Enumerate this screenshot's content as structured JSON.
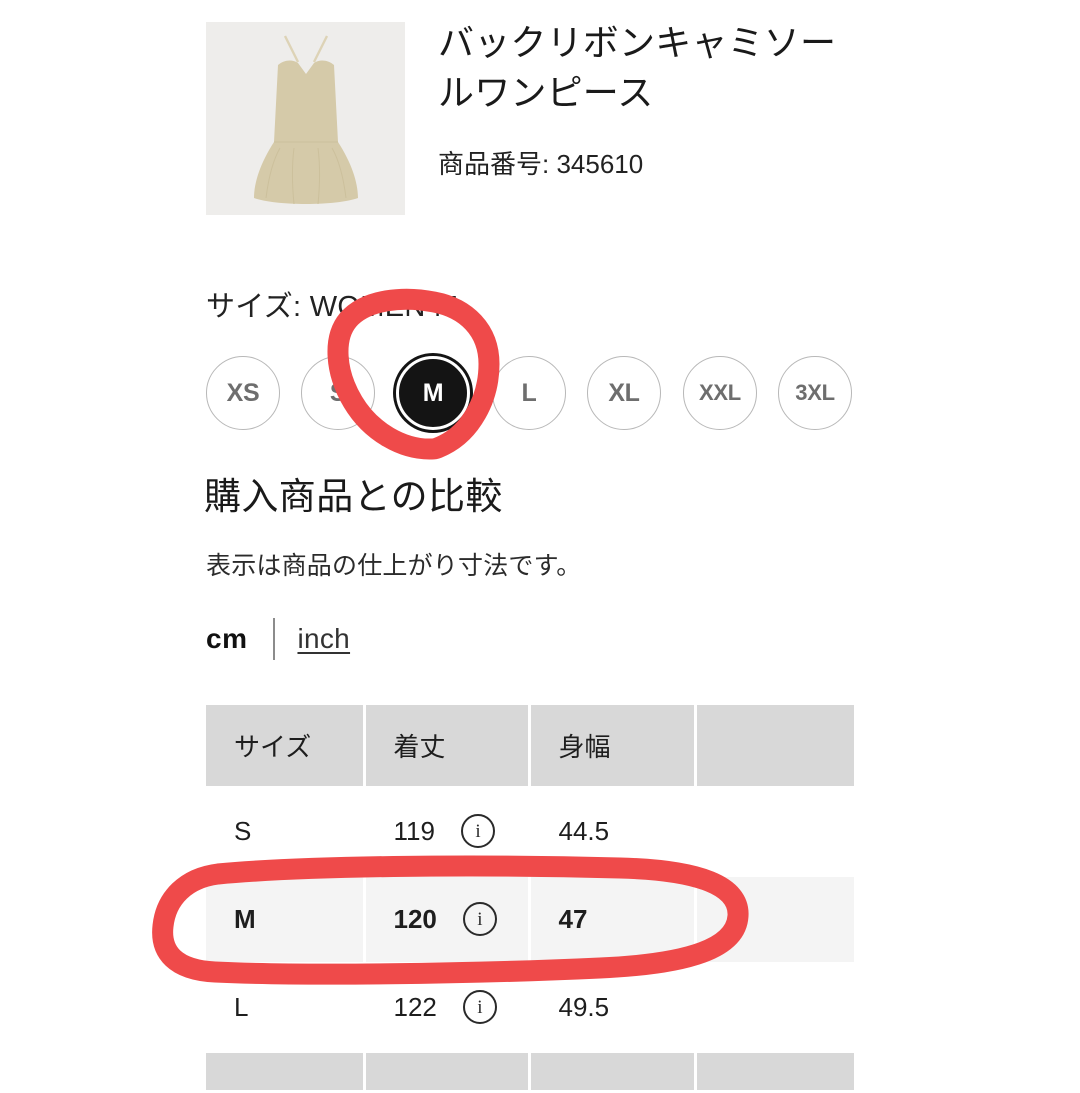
{
  "product": {
    "title": "バックリボンキャミソールワンピース",
    "code_label": "商品番号: 345610",
    "image_alt": "beige-camisole-dress",
    "image_bg": "#eeeeee",
    "garment_color": "#d5caa9"
  },
  "size_selector": {
    "label": "サイズ: WOMEN M",
    "selected": "M",
    "options": [
      {
        "label": "XS",
        "selected": false
      },
      {
        "label": "S",
        "selected": false
      },
      {
        "label": "M",
        "selected": true
      },
      {
        "label": "L",
        "selected": false
      },
      {
        "label": "XL",
        "selected": false
      },
      {
        "label": "XXL",
        "selected": false
      },
      {
        "label": "3XL",
        "selected": false
      }
    ]
  },
  "compare": {
    "heading": "購入商品との比較",
    "note": "表示は商品の仕上がり寸法です。"
  },
  "units": {
    "cm_label": "cm",
    "inch_label": "inch",
    "active": "cm"
  },
  "size_table": {
    "headers": [
      "サイズ",
      "着丈",
      "身幅",
      ""
    ],
    "info_icon": "i",
    "rows": [
      {
        "size": "S",
        "length": "119",
        "width": "44.5",
        "extra": "",
        "highlight": false,
        "has_info": true
      },
      {
        "size": "M",
        "length": "120",
        "width": "47",
        "extra": "",
        "highlight": true,
        "has_info": true
      },
      {
        "size": "L",
        "length": "122",
        "width": "49.5",
        "extra": "",
        "highlight": false,
        "has_info": true
      }
    ]
  },
  "annotations": {
    "color": "#ef4a4a",
    "marks": [
      {
        "name": "circle-around-size-m",
        "shape": "loop"
      },
      {
        "name": "oval-around-m-table-row",
        "shape": "loop"
      }
    ]
  }
}
